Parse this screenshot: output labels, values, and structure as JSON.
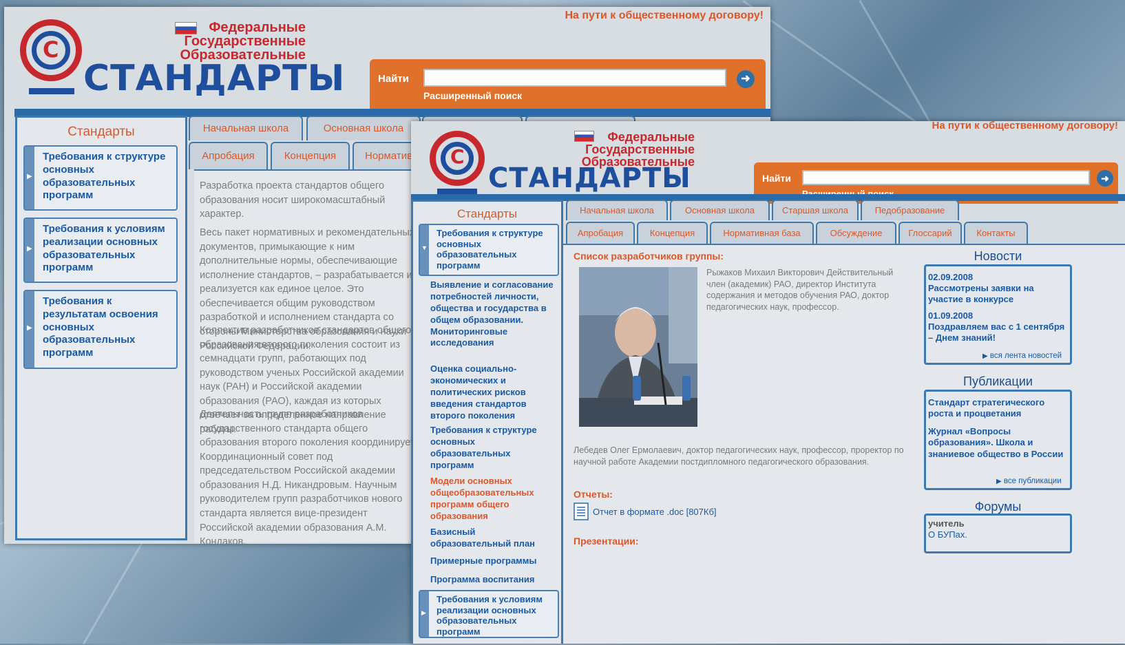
{
  "slogan": "На пути к общественному договору!",
  "logo": {
    "line1": "Федеральные",
    "line2": "Государственные",
    "line3": "Образовательные",
    "brand": "СТАНДАРТЫ"
  },
  "search": {
    "label": "Найти",
    "advanced": "Расширенный поиск",
    "value": ""
  },
  "colors": {
    "accent": "#e0712b",
    "brand": "#1f4f9c",
    "title": "#d9582b",
    "link": "#1a5aa0"
  },
  "back": {
    "sidebar_title": "Стандарты",
    "sidebar_items": [
      "Требования к структуре основных образовательных программ",
      "Требования к условиям реализации основных образовательных программ",
      "Требования к результатам освоения основных образовательных программ"
    ],
    "tabs_row1": [
      "Начальная школа",
      "Основная школа"
    ],
    "tabs_row2": [
      "Апробация",
      "Концепция",
      "Нормативная база"
    ],
    "paragraphs": [
      "Разработка проекта стандартов общего образования носит широкомасштабный характер.",
      "Весь пакет нормативных и рекомендательных документов, примыкающие к ним дополнительные нормы, обеспечивающие исполнение стандартов, – разрабатывается и реализуется как единое целое. Это обеспечивается общим руководством разработкой и исполнением стандарта со стороны Министерства образования и науки Российской Федерации.",
      "Коллектив разработчиков стандартов общего образования второго поколения состоит из семнадцати групп, работающих под руководством ученых Российской академии наук (РАН) и Российской академии образования (РАО), каждая из которых отвечает за определенное направление работы.",
      "Деятельность групп разработчиков государственного стандарта общего образования второго поколения координирует Координационный совет под председательством Российской академии образования Н.Д. Никандровым. Научным руководителем групп разработчиков нового стандарта является вице-президент Российской академии образования А.М. Кондаков."
    ]
  },
  "front": {
    "sidebar_title": "Стандарты",
    "sidebar_top_box": "Требования к структуре основных образовательных программ",
    "sidebar_links": [
      {
        "label": "Выявление и согласование потребностей личности, общества и государства в общем образовании. Мониторинговые исследования",
        "active": false
      },
      {
        "label": "Оценка социально-экономических и политических рисков введения стандартов второго поколения",
        "active": false
      },
      {
        "label": "Требования к структуре основных образовательных программ",
        "active": false
      },
      {
        "label": "Модели основных общеобразовательных программ общего образования",
        "active": true
      },
      {
        "label": "Базисный образовательный план",
        "active": false
      },
      {
        "label": "Примерные программы",
        "active": false
      },
      {
        "label": "Программа воспитания",
        "active": false
      }
    ],
    "sidebar_bottom_box": "Требования к условиям реализации основных образовательных программ",
    "tabs_row1": [
      "Начальная школа",
      "Основная школа",
      "Старшая школа",
      "Педобразование"
    ],
    "tabs_row2": [
      "Апробация",
      "Концепция",
      "Нормативная база",
      "Обсуждение",
      "Глоссарий",
      "Контакты"
    ],
    "content": {
      "heading": "Список разработчиков группы:",
      "person1": "Рыжаков Михаил Викторович Действительный член (академик) РАО, директор Института содержания и методов обучения РАО, доктор педагогических наук, профессор.",
      "person2": "Лебедев Олег Ермолаевич, доктор педагогических наук, профессор, проректор по научной работе Академии постдипломного педагогического образования.",
      "reports_heading": "Отчеты:",
      "report_link": "Отчет в формате .doc [807Кб]",
      "presentations_heading": "Презентации:"
    },
    "news": {
      "title": "Новости",
      "items": [
        {
          "date": "02.09.2008",
          "text": "Рассмотрены заявки на участие в конкурсе"
        },
        {
          "date": "01.09.2008",
          "text": "Поздравляем вас с 1 сентября – Днем знаний!"
        }
      ],
      "more": "вся лента новостей"
    },
    "publications": {
      "title": "Публикации",
      "items": [
        "Стандарт стратегического роста и процветания",
        "Журнал «Вопросы образования». Школа и знаниевое общество в России"
      ],
      "more": "все публикации"
    },
    "forums": {
      "title": "Форумы",
      "user": "учитель",
      "topic": "О БУПах."
    }
  }
}
